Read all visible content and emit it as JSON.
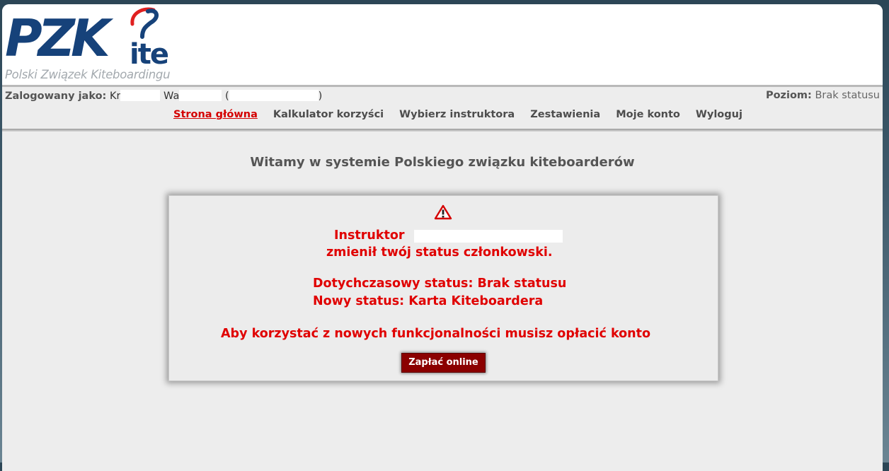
{
  "header": {
    "logo_text": "PZK",
    "logo_suffix": "ite",
    "logo_subtitle": "Polski Związek Kiteboardingu"
  },
  "user_bar": {
    "logged_label": "Zalogowany jako:",
    "name_first_visible": "Kr",
    "name_second_visible": "Wa",
    "level_label": "Poziom:",
    "level_value": "Brak statusu"
  },
  "nav": {
    "items": [
      "Strona główna",
      "Kalkulator korzyści",
      "Wybierz instruktora",
      "Zestawienia",
      "Moje konto",
      "Wyloguj"
    ],
    "active_index": 0
  },
  "main": {
    "welcome": "Witamy w systemie Polskiego związku kiteboarderów"
  },
  "notice": {
    "icon": "warning-triangle-icon",
    "instructor_label": "Instruktor",
    "changed_text": "zmienił twój status członkowski.",
    "previous_status": "Dotychczasowy status: Brak statusu",
    "new_status": "Nowy status: Karta Kiteboardera",
    "pay_prompt": "Aby korzystać z nowych funkcjonalności musisz opłacić konto",
    "pay_button": "Zapłać online"
  },
  "colors": {
    "brand_blue": "#16427a",
    "alert_red": "#e00000",
    "active_nav": "#d40000",
    "button_dark_red": "#8b0000"
  }
}
